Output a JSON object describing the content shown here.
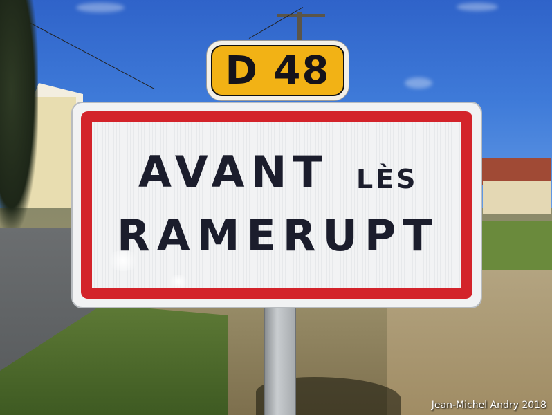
{
  "route_plate": {
    "text": "D 48",
    "background_color": "#f2b215",
    "text_color": "#15131a"
  },
  "town_sign": {
    "line1_main": "AVANT",
    "line1_small": "LÈS",
    "line2": "RAMERUPT",
    "border_color": "#d3232a",
    "text_color": "#1b1d2c"
  },
  "credit": "Jean-Michel Andry 2018"
}
